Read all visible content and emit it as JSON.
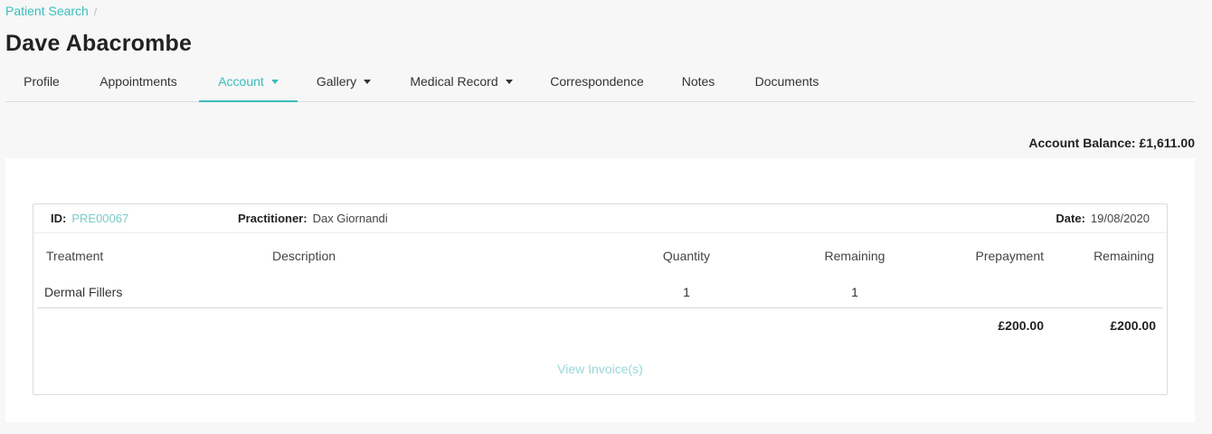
{
  "breadcrumb": {
    "link": "Patient Search",
    "separator": "/"
  },
  "page_title": "Dave Abacrombe",
  "tabs": [
    {
      "label": "Profile"
    },
    {
      "label": "Appointments"
    },
    {
      "label": "Account",
      "active": true,
      "dropdown": true
    },
    {
      "label": "Gallery",
      "dropdown": true
    },
    {
      "label": "Medical Record",
      "dropdown": true
    },
    {
      "label": "Correspondence"
    },
    {
      "label": "Notes"
    },
    {
      "label": "Documents"
    }
  ],
  "account_balance": "Account Balance: £1,611.00",
  "invoice": {
    "id_label": "ID:",
    "id_value": "PRE00067",
    "practitioner_label": "Practitioner:",
    "practitioner_value": "Dax Giornandi",
    "date_label": "Date:",
    "date_value": "19/08/2020",
    "columns": [
      "Treatment",
      "Description",
      "Quantity",
      "Remaining",
      "Prepayment",
      "Remaining"
    ],
    "rows": [
      {
        "treatment": "Dermal Fillers",
        "description": "",
        "quantity": "1",
        "remaining": "1"
      }
    ],
    "totals": {
      "prepayment": "£200.00",
      "remaining": "£200.00"
    },
    "view_invoices": "View Invoice(s)"
  },
  "colors": {
    "accent": "#3bbdbd",
    "link_muted": "#9ad7d7",
    "background": "#f7f7f7"
  }
}
